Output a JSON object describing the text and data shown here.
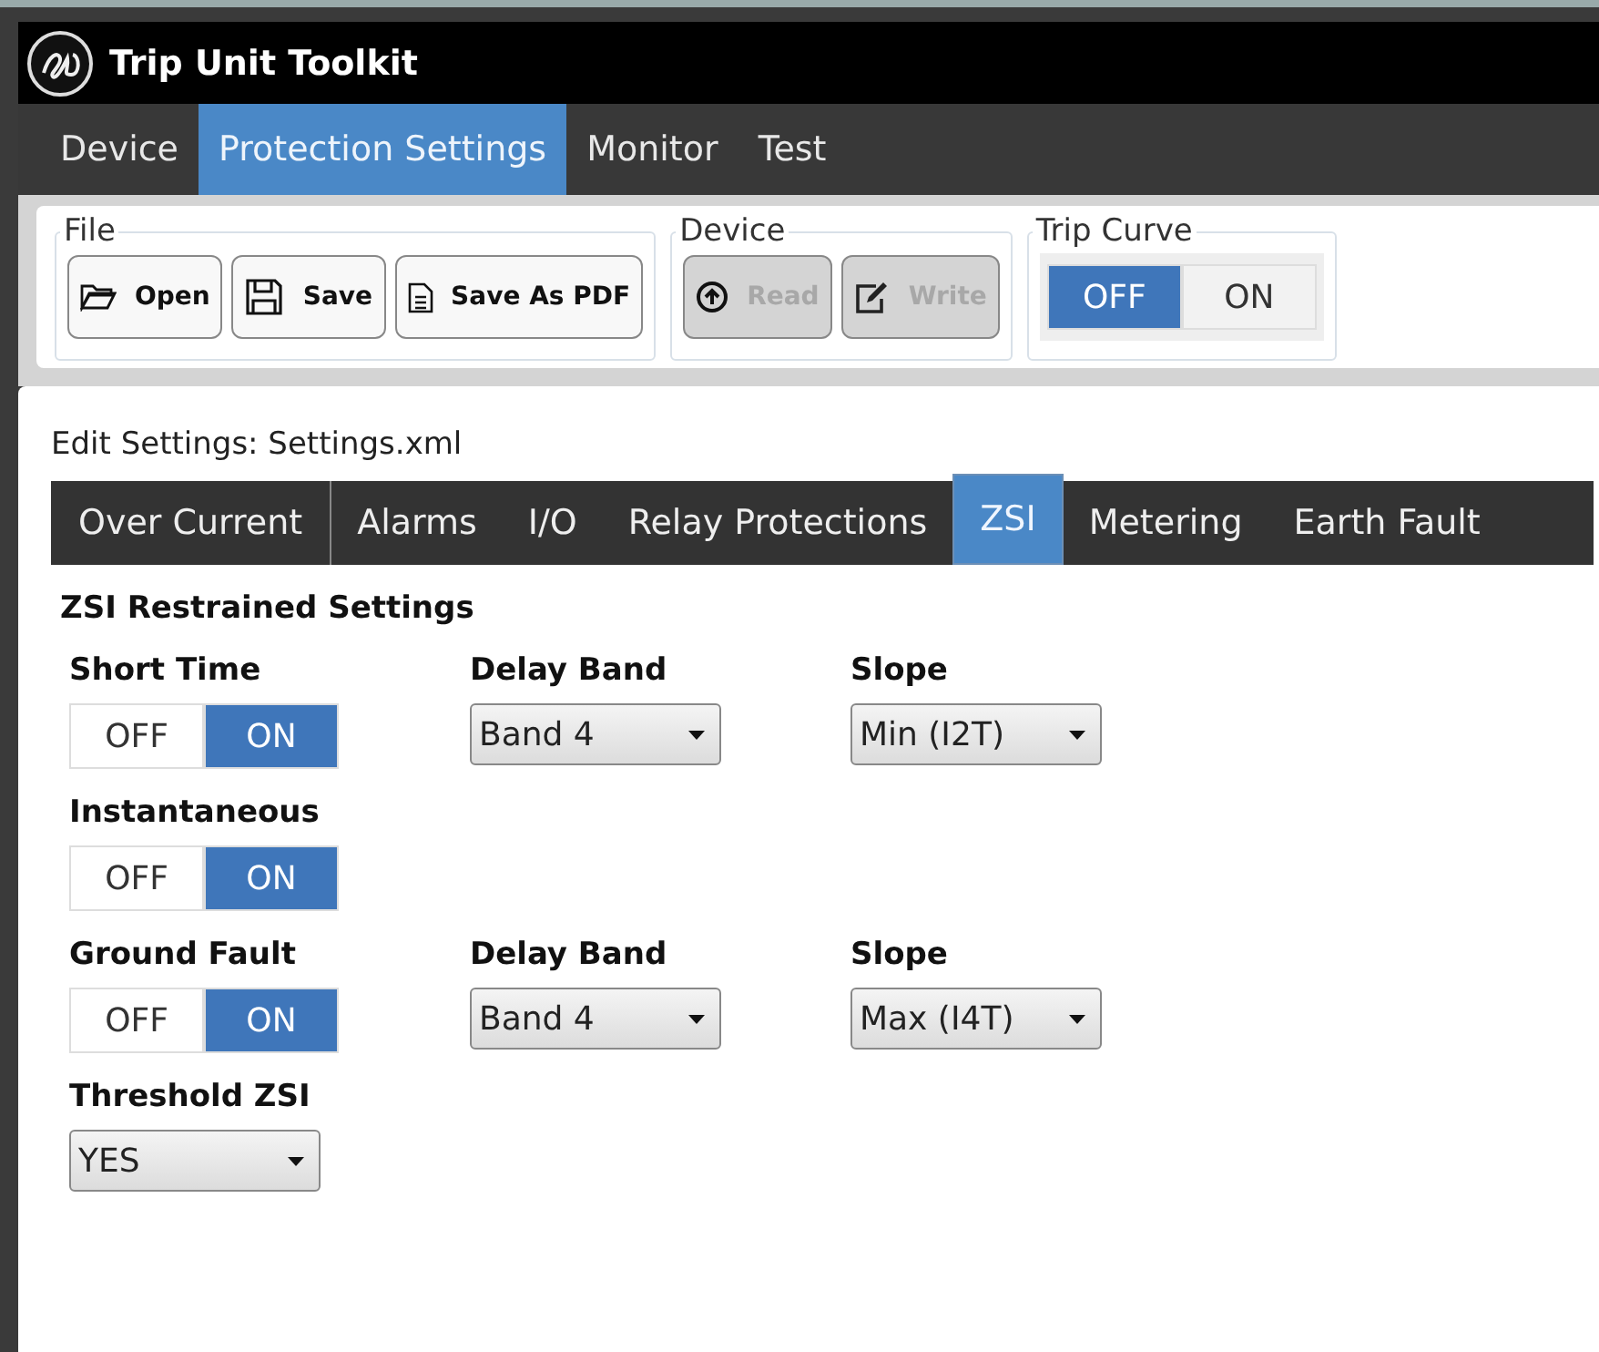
{
  "window": {
    "title": "Trip Unit Toolkit"
  },
  "menu": [
    {
      "label": "Device",
      "selected": false
    },
    {
      "label": "Protection Settings",
      "selected": true
    },
    {
      "label": "Monitor",
      "selected": false
    },
    {
      "label": "Test",
      "selected": false
    }
  ],
  "toolbar": [
    {
      "title": "File",
      "kind": "buttons",
      "buttons": [
        {
          "label": "Open",
          "disabled": false
        },
        {
          "label": "Save",
          "disabled": false
        },
        {
          "label": "Save As PDF",
          "disabled": false
        }
      ]
    },
    {
      "title": "Device",
      "kind": "buttons",
      "buttons": [
        {
          "label": "Read",
          "disabled": true
        },
        {
          "label": "Write",
          "disabled": true
        }
      ]
    },
    {
      "title": "Trip Curve",
      "kind": "toggle",
      "options": [
        {
          "label": "OFF",
          "selected": true
        },
        {
          "label": "ON",
          "selected": false
        }
      ]
    }
  ],
  "edit_title": "Edit Settings: Settings.xml",
  "tabs": [
    {
      "label": "Over Current",
      "selected": false
    },
    {
      "label": "Alarms",
      "selected": false
    },
    {
      "label": "I/O",
      "selected": false
    },
    {
      "label": "Relay Protections",
      "selected": false
    },
    {
      "label": "ZSI",
      "selected": true
    },
    {
      "label": "Metering",
      "selected": false
    },
    {
      "label": "Earth Fault",
      "selected": false
    }
  ],
  "section_title": "ZSI Restrained Settings",
  "rows": [
    [
      {
        "kind": "toggle",
        "label": "Short Time",
        "options": [
          {
            "label": "OFF",
            "selected": false
          },
          {
            "label": "ON",
            "selected": true
          }
        ]
      },
      {
        "kind": "dropdown",
        "label": "Delay Band",
        "value": "Band 4"
      },
      {
        "kind": "dropdown",
        "label": "Slope",
        "value": "Min (I2T)"
      }
    ],
    [
      {
        "kind": "toggle",
        "label": "Instantaneous",
        "options": [
          {
            "label": "OFF",
            "selected": false
          },
          {
            "label": "ON",
            "selected": true
          }
        ]
      }
    ],
    [
      {
        "kind": "toggle",
        "label": "Ground Fault",
        "options": [
          {
            "label": "OFF",
            "selected": false
          },
          {
            "label": "ON",
            "selected": true
          }
        ]
      },
      {
        "kind": "dropdown",
        "label": "Delay Band",
        "value": "Band 4"
      },
      {
        "kind": "dropdown",
        "label": "Slope",
        "value": "Max (I4T)"
      }
    ],
    [
      {
        "kind": "dropdown",
        "label": "Threshold ZSI",
        "value": "YES"
      }
    ]
  ]
}
